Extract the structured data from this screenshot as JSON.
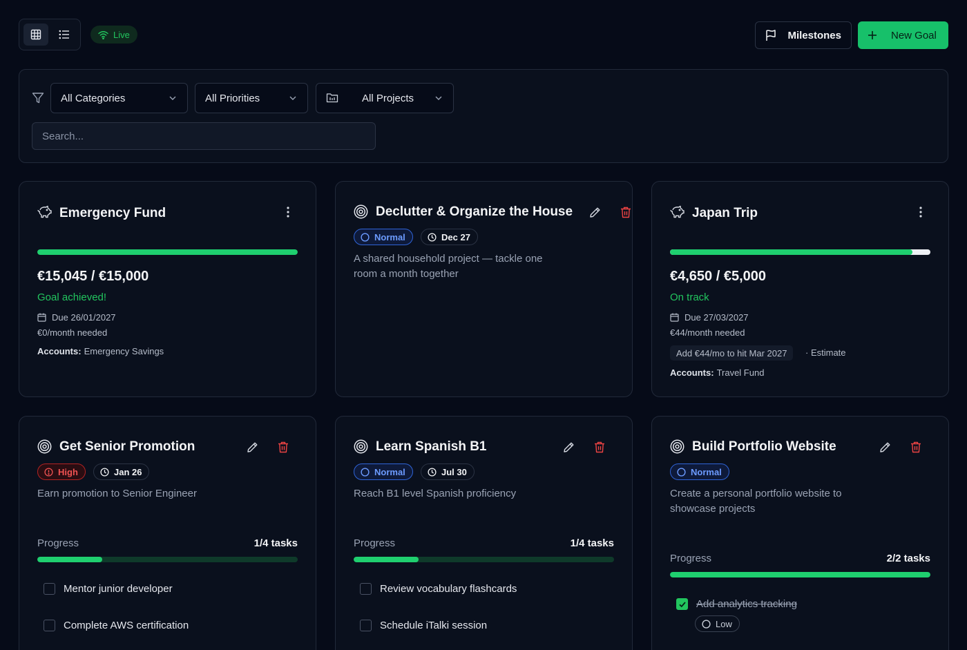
{
  "toolbar": {
    "live_label": "Live",
    "milestones_label": "Milestones",
    "new_goal_label": "New Goal"
  },
  "filters": {
    "categories": "All Categories",
    "priorities": "All Priorities",
    "projects": "All Projects",
    "search_placeholder": "Search..."
  },
  "colors": {
    "accent_green": "#17c06a",
    "normal_blue": "#6c9bff",
    "high_red": "#f05252",
    "bg": "#060b18"
  },
  "goals": [
    {
      "title": "Emergency Fund",
      "amount": "€15,045 / €15,000",
      "progress": 1.0,
      "status": "Goal achieved!",
      "due": "Due 26/01/2027",
      "monthly": "€0/month needed",
      "accounts_label": "Accounts:",
      "accounts": "Emergency Savings"
    },
    {
      "title": "Declutter & Organize the House",
      "priority": "Normal",
      "date": "Dec 27",
      "description": "A shared household project — tackle one room a month together"
    },
    {
      "title": "Japan Trip",
      "amount": "€4,650 / €5,000",
      "progress": 0.93,
      "status": "On track",
      "due": "Due 27/03/2027",
      "monthly": "€44/month needed",
      "suggestion": "Add €44/mo to hit Mar 2027",
      "estimate": "· Estimate",
      "accounts_label": "Accounts:",
      "accounts": "Travel Fund"
    },
    {
      "title": "Get Senior Promotion",
      "priority": "High",
      "date": "Jan 26",
      "description": "Earn promotion to Senior Engineer",
      "progress_label": "Progress",
      "tasks_count": "1/4 tasks",
      "progress": 0.25,
      "tasks": [
        {
          "label": "Mentor junior developer",
          "done": false
        },
        {
          "label": "Complete AWS certification",
          "done": false
        }
      ]
    },
    {
      "title": "Learn Spanish B1",
      "priority": "Normal",
      "date": "Jul 30",
      "description": "Reach B1 level Spanish proficiency",
      "progress_label": "Progress",
      "tasks_count": "1/4 tasks",
      "progress": 0.25,
      "tasks": [
        {
          "label": "Review vocabulary flashcards",
          "done": false
        },
        {
          "label": "Schedule iTalki session",
          "done": false
        }
      ]
    },
    {
      "title": "Build Portfolio Website",
      "priority": "Normal",
      "description": "Create a personal portfolio website to showcase projects",
      "progress_label": "Progress",
      "tasks_count": "2/2 tasks",
      "progress": 1.0,
      "tasks": [
        {
          "label": "Add analytics tracking",
          "done": true,
          "priority": "Low"
        }
      ]
    }
  ]
}
